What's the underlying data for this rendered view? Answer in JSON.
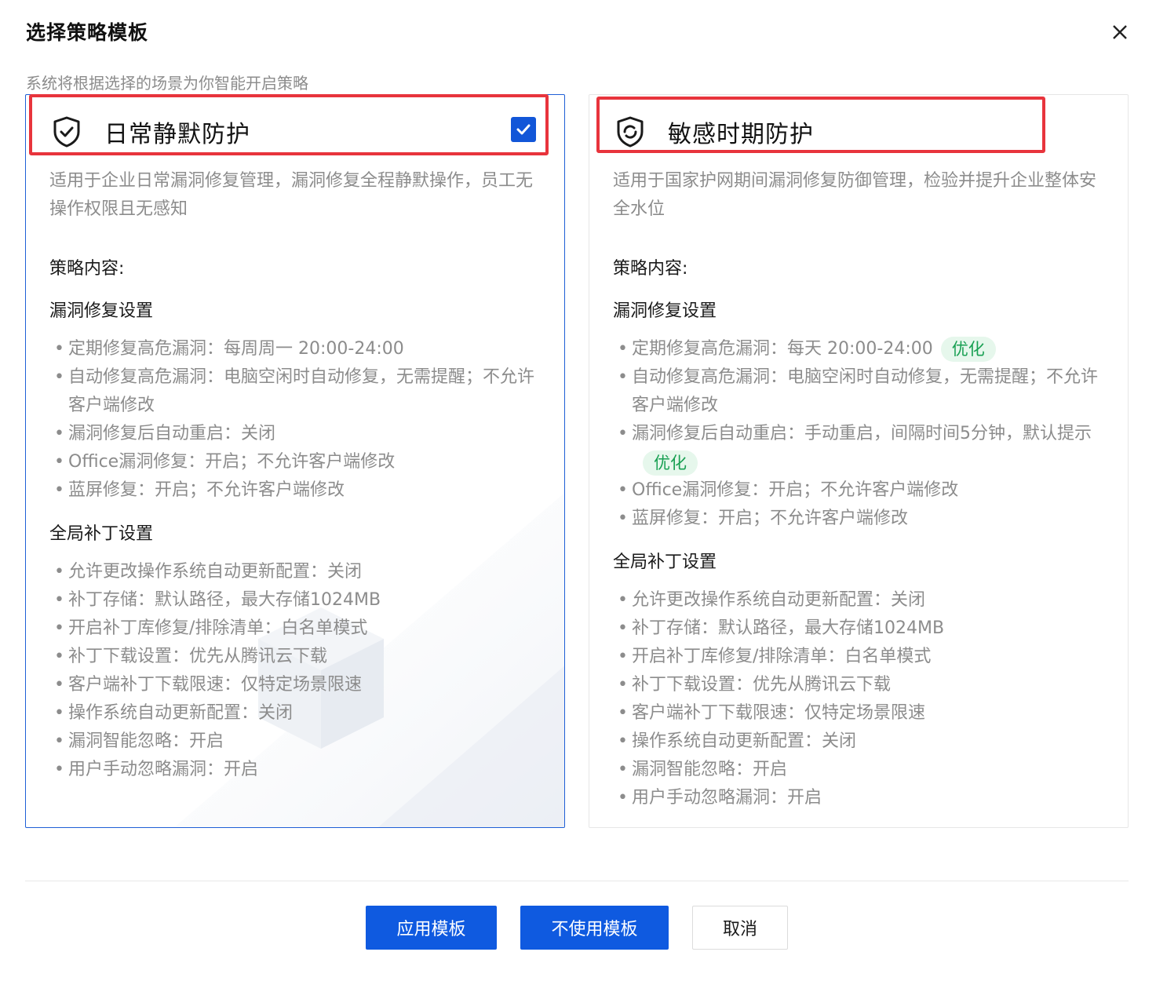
{
  "dialog": {
    "title": "选择策略模板",
    "subtitle": "系统将根据选择的场景为你智能开启策略"
  },
  "cards": [
    {
      "name": "日常静默防护",
      "selected": true,
      "icon": "shield-check-icon",
      "description": "适用于企业日常漏洞修复管理，漏洞修复全程静默操作，员工无操作权限且无感知",
      "content_label": "策略内容:",
      "sections": [
        {
          "title": "漏洞修复设置",
          "items": [
            {
              "text": "定期修复高危漏洞：每周周一 20:00-24:00"
            },
            {
              "text": "自动修复高危漏洞：电脑空闲时自动修复，无需提醒；不允许客户端修改"
            },
            {
              "text": "漏洞修复后自动重启：关闭"
            },
            {
              "text": "Office漏洞修复：开启；不允许客户端修改"
            },
            {
              "text": "蓝屏修复：开启；不允许客户端修改"
            }
          ]
        },
        {
          "title": "全局补丁设置",
          "items": [
            {
              "text": "允许更改操作系统自动更新配置：关闭"
            },
            {
              "text": "补丁存储：默认路径，最大存储1024MB"
            },
            {
              "text": "开启补丁库修复/排除清单：白名单模式"
            },
            {
              "text": "补丁下载设置：优先从腾讯云下载"
            },
            {
              "text": "客户端补丁下载限速：仅特定场景限速"
            },
            {
              "text": "操作系统自动更新配置：关闭"
            },
            {
              "text": "漏洞智能忽略：开启"
            },
            {
              "text": "用户手动忽略漏洞：开启"
            }
          ]
        }
      ]
    },
    {
      "name": "敏感时期防护",
      "selected": false,
      "icon": "shield-refresh-icon",
      "description": "适用于国家护网期间漏洞修复防御管理，检验并提升企业整体安全水位",
      "content_label": "策略内容:",
      "sections": [
        {
          "title": "漏洞修复设置",
          "items": [
            {
              "text": "定期修复高危漏洞：每天 20:00-24:00",
              "tag": "优化"
            },
            {
              "text": "自动修复高危漏洞：电脑空闲时自动修复，无需提醒；不允许客户端修改"
            },
            {
              "text": "漏洞修复后自动重启：手动重启，间隔时间5分钟，默认提示",
              "tag": "优化"
            },
            {
              "text": "Office漏洞修复：开启；不允许客户端修改"
            },
            {
              "text": "蓝屏修复：开启；不允许客户端修改"
            }
          ]
        },
        {
          "title": "全局补丁设置",
          "items": [
            {
              "text": "允许更改操作系统自动更新配置：关闭"
            },
            {
              "text": "补丁存储：默认路径，最大存储1024MB"
            },
            {
              "text": "开启补丁库修复/排除清单：白名单模式"
            },
            {
              "text": "补丁下载设置：优先从腾讯云下载"
            },
            {
              "text": "客户端补丁下载限速：仅特定场景限速"
            },
            {
              "text": "操作系统自动更新配置：关闭"
            },
            {
              "text": "漏洞智能忽略：开启"
            },
            {
              "text": "用户手动忽略漏洞：开启"
            }
          ]
        }
      ]
    }
  ],
  "footer": {
    "apply_label": "应用模板",
    "no_template_label": "不使用模板",
    "cancel_label": "取消"
  },
  "colors": {
    "primary": "#0f5ae0",
    "highlight": "#e8343c",
    "tag_bg": "#e6f7ec",
    "tag_text": "#19a053"
  }
}
